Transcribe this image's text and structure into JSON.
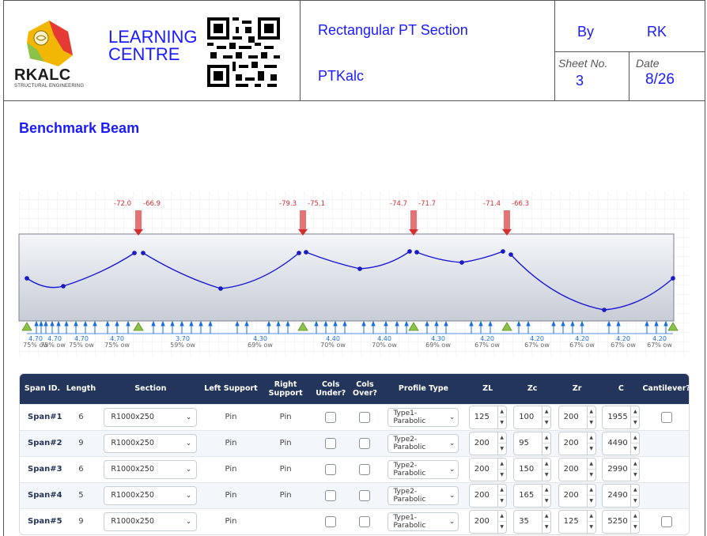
{
  "header": {
    "logo_text": "RKALC",
    "logo_sub": "STRUCTURAL ENGINEERING",
    "learning_line1": "LEARNING",
    "learning_line2": "CENTRE",
    "project_title": "Rectangular PT Section",
    "project_sub": "PTKalc",
    "by_label": "By",
    "by_value": "RK",
    "sheet_label": "Sheet No.",
    "sheet_value": "3",
    "date_label": "Date",
    "date_value": "8/26"
  },
  "section_title": "Benchmark Beam",
  "beam": {
    "reactions": [
      {
        "left": "-72.0",
        "right": "-66.9"
      },
      {
        "left": "-79.3",
        "right": "-75.1"
      },
      {
        "left": "-74.7",
        "right": "-71.7"
      },
      {
        "left": "-71.4",
        "right": "-66.3"
      }
    ],
    "loads": [
      {
        "value": "4.70",
        "pct": "75% ow"
      },
      {
        "value": "4.70",
        "pct": "75% ow"
      },
      {
        "value": "4.70",
        "pct": "75% ow"
      },
      {
        "value": "4.70",
        "pct": "75% ow"
      },
      {
        "value": "3.70",
        "pct": "59% ow"
      },
      {
        "value": "4.30",
        "pct": "69% ow"
      },
      {
        "value": "4.40",
        "pct": "70% ow"
      },
      {
        "value": "4.40",
        "pct": "70% ow"
      },
      {
        "value": "4.30",
        "pct": "69% ow"
      },
      {
        "value": "4.20",
        "pct": "67% ow"
      },
      {
        "value": "4.20",
        "pct": "67% ow"
      },
      {
        "value": "4.20",
        "pct": "67% ow"
      },
      {
        "value": "4.20",
        "pct": "67% ow"
      },
      {
        "value": "4.20",
        "pct": "67% ow"
      }
    ]
  },
  "table": {
    "headers": [
      "Span ID.",
      "Length",
      "Section",
      "Left Support",
      "Right Support",
      "Cols Under?",
      "Cols Over?",
      "Profile Type",
      "ZL",
      "Zc",
      "Zr",
      "C",
      "Cantilever?"
    ],
    "rows": [
      {
        "id": "Span#1",
        "length": "6",
        "section": "R1000x250",
        "left": "Pin",
        "right": "Pin",
        "profile": "Type1-Parabolic",
        "zl": "125",
        "zc": "100",
        "zr": "200",
        "c": "1955",
        "cant": true
      },
      {
        "id": "Span#2",
        "length": "9",
        "section": "R1000x250",
        "left": "Pin",
        "right": "Pin",
        "profile": "Type2-Parabolic",
        "zl": "200",
        "zc": "95",
        "zr": "200",
        "c": "4490",
        "cant": false
      },
      {
        "id": "Span#3",
        "length": "6",
        "section": "R1000x250",
        "left": "Pin",
        "right": "Pin",
        "profile": "Type2-Parabolic",
        "zl": "200",
        "zc": "150",
        "zr": "200",
        "c": "2990",
        "cant": false
      },
      {
        "id": "Span#4",
        "length": "5",
        "section": "R1000x250",
        "left": "Pin",
        "right": "Pin",
        "profile": "Type2-Parabolic",
        "zl": "200",
        "zc": "165",
        "zr": "200",
        "c": "2490",
        "cant": false
      },
      {
        "id": "Span#5",
        "length": "9",
        "section": "R1000x250",
        "left": "Pin",
        "right": "",
        "profile": "Type1-Parabolic",
        "zl": "200",
        "zc": "35",
        "zr": "125",
        "c": "5250",
        "cant": true
      }
    ]
  },
  "colors": {
    "accent": "#1a1aff",
    "table_header": "#23355a",
    "reaction": "#d32f2f",
    "tendon": "#1a1ad6",
    "support": "#8bc34a",
    "load": "#1e6fd9"
  }
}
